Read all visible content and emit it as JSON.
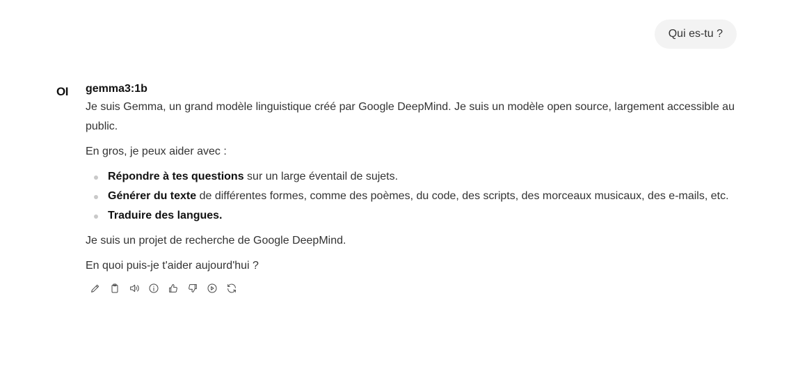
{
  "user_message": "Qui es-tu ?",
  "assistant": {
    "avatar_text": "OI",
    "model_name": "gemma3:1b",
    "paragraph1": "Je suis Gemma, un grand modèle linguistique créé par Google DeepMind. Je suis un modèle open source, largement accessible au public.",
    "paragraph2": "En gros, je peux aider avec :",
    "bullets": [
      {
        "bold": "Répondre à tes questions",
        "rest": " sur un large éventail de sujets."
      },
      {
        "bold": "Générer du texte",
        "rest": " de différentes formes, comme des poèmes, du code, des scripts, des morceaux musicaux, des e-mails, etc."
      },
      {
        "bold": "Traduire des langues.",
        "rest": ""
      }
    ],
    "paragraph3": "Je suis un projet de recherche de Google DeepMind.",
    "paragraph4": "En quoi puis-je t'aider aujourd'hui ?"
  },
  "actions": [
    {
      "icon": "pencil-icon",
      "label": "Edit"
    },
    {
      "icon": "clipboard-icon",
      "label": "Copy"
    },
    {
      "icon": "speaker-icon",
      "label": "Read aloud"
    },
    {
      "icon": "info-icon",
      "label": "Generation info"
    },
    {
      "icon": "thumbs-up-icon",
      "label": "Good response"
    },
    {
      "icon": "thumbs-down-icon",
      "label": "Bad response"
    },
    {
      "icon": "play-circle-icon",
      "label": "Continue response"
    },
    {
      "icon": "refresh-icon",
      "label": "Regenerate"
    }
  ]
}
